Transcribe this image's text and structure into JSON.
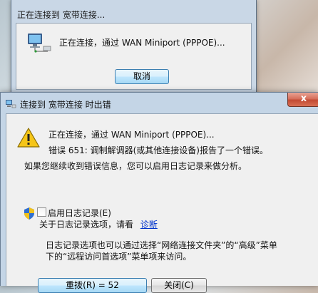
{
  "bg_dialog": {
    "title": "正在连接到 宽带连接...",
    "message": "正在连接，通过 WAN Miniport (PPPOE)...",
    "cancel_label": "取消"
  },
  "error_dialog": {
    "title": "连接到 宽带连接 时出错",
    "close_glyph": "x",
    "connecting_line": "正在连接，通过 WAN Miniport (PPPOE)...",
    "error_line": "错误 651: 调制解调器(或其他连接设备)报告了一个错误。",
    "hint_line": "如果您继续收到错误信息，您可以启用日志记录来做分析。",
    "logging": {
      "checkbox_label": "启用日志记录(E)",
      "about_text": "关于日志记录选项，请看",
      "diagnose_link": "诊断"
    },
    "note_line1": "日志记录选项也可以通过选择“网络连接文件夹”的“高级”菜单",
    "note_line2": "下的“远程访问首选项”菜单项来访问。",
    "redial_label": "重拨(R) = 52",
    "close_label": "关闭(C)"
  }
}
